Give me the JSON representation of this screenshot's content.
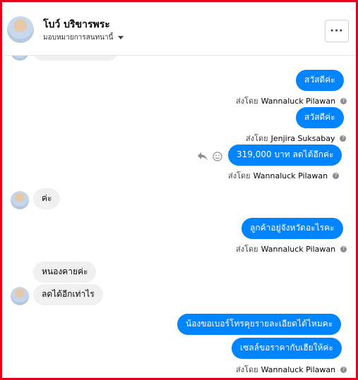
{
  "header": {
    "name": "โบว์ บริขารพระ",
    "subtitle": "มอบหมายการสนทนานี้",
    "more_label": "···"
  },
  "messages": [
    {
      "type": "out",
      "text": "สวัสดีค่ะ",
      "sender": "Wannaluck Pilawan"
    },
    {
      "type": "out",
      "text": "สวัสดีค่ะ",
      "sender": "Jenjira Suksabay"
    },
    {
      "type": "out",
      "text": "319,000  บาท ลดได้อีกค่ะ",
      "sender": "Wannaluck Pilawan"
    },
    {
      "type": "in",
      "text": "ค่ะ"
    },
    {
      "type": "out",
      "text": "ลูกค้าอยู่จังหวัดอะไรคะ",
      "sender": "Wannaluck Pilawan"
    },
    {
      "type": "in",
      "text": "หนองคายค่ะ"
    },
    {
      "type": "in",
      "text": "ลดได้อีกเท่าไร"
    },
    {
      "type": "out",
      "text": "น้องขอเบอร์โทรคุยรายละเอียดได้ไหมคะ"
    },
    {
      "type": "out",
      "text": "เซลล์ขอราคากับเฮียให้ค่ะ",
      "sender": "Wannaluck Pilawan"
    }
  ],
  "sent_by_label": "ส่งโดย",
  "help_glyph": "?",
  "colors": {
    "outgoing": "#0084ff",
    "incoming": "#f0f0f0",
    "frame": "#e4001b"
  }
}
